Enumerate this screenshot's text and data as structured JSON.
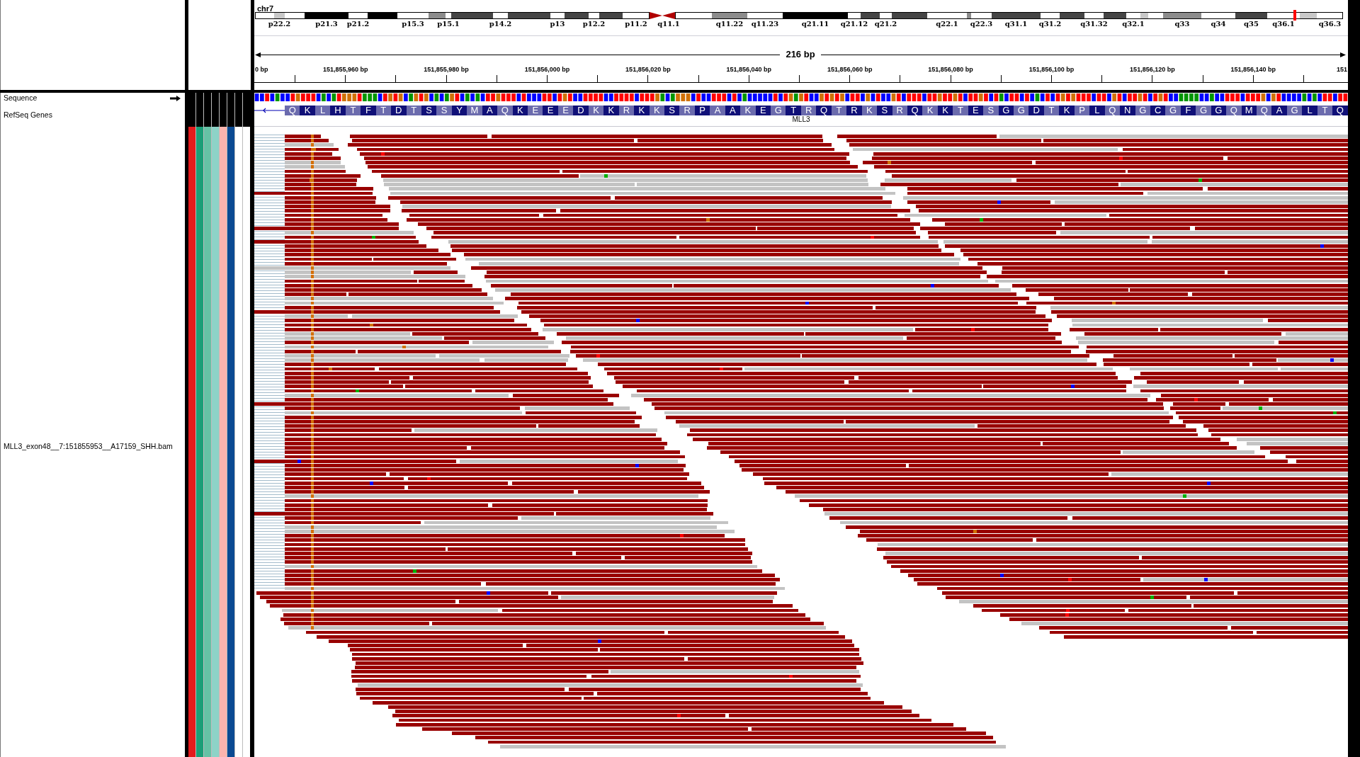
{
  "ideogram": {
    "chromosome": "chr7",
    "bands": [
      {
        "kind": "band",
        "color": "#ffffff",
        "current": false
      },
      {
        "label": "p22.2",
        "kind": "band",
        "color": "#c8c8c8",
        "current": false
      },
      {
        "kind": "band",
        "color": "#ffffff",
        "current": false
      },
      {
        "label": "p21.3",
        "kind": "band",
        "color": "#000000",
        "current": false
      },
      {
        "label": "p21.2",
        "kind": "band",
        "color": "#ffffff",
        "current": false
      },
      {
        "kind": "band",
        "color": "#000000",
        "current": false
      },
      {
        "label": "p15.3",
        "kind": "band",
        "color": "#ffffff",
        "current": false
      },
      {
        "kind": "band",
        "color": "#8c8c8c",
        "current": false
      },
      {
        "label": "p15.1",
        "kind": "band",
        "color": "#ffffff",
        "current": false
      },
      {
        "kind": "band",
        "color": "#454545",
        "current": false
      },
      {
        "label": "p14.2",
        "kind": "band",
        "color": "#ffffff",
        "current": false
      },
      {
        "kind": "band",
        "color": "#454545",
        "current": false
      },
      {
        "label": "p13",
        "kind": "band",
        "color": "#ffffff",
        "current": false
      },
      {
        "kind": "band",
        "color": "#454545",
        "current": false
      },
      {
        "label": "p12.2",
        "kind": "band",
        "color": "#ffffff",
        "current": false
      },
      {
        "kind": "band",
        "color": "#454545",
        "current": false
      },
      {
        "label": "p11.2",
        "kind": "band",
        "color": "#ffffff",
        "current": false
      },
      {
        "kind": "centromere",
        "color": "#b00000",
        "current": false
      },
      {
        "label": "q11.1",
        "kind": "centromere",
        "color": "#b00000",
        "current": false
      },
      {
        "kind": "band",
        "color": "#ffffff",
        "current": false
      },
      {
        "label": "q11.22",
        "kind": "band",
        "color": "#8c8c8c",
        "current": false
      },
      {
        "label": "q11.23",
        "kind": "band",
        "color": "#ffffff",
        "current": false
      },
      {
        "label": "q21.11",
        "kind": "band",
        "color": "#000000",
        "current": false
      },
      {
        "label": "q21.12",
        "kind": "band",
        "color": "#ffffff",
        "current": false
      },
      {
        "kind": "band",
        "color": "#454545",
        "current": false
      },
      {
        "label": "q21.2",
        "kind": "band",
        "color": "#ffffff",
        "current": false
      },
      {
        "kind": "band",
        "color": "#454545",
        "current": false
      },
      {
        "label": "q22.1",
        "kind": "band",
        "color": "#ffffff",
        "current": false
      },
      {
        "kind": "band",
        "color": "#8c8c8c",
        "current": false
      },
      {
        "label": "q22.3",
        "kind": "band",
        "color": "#ffffff",
        "current": false
      },
      {
        "label": "q31.1",
        "kind": "band",
        "color": "#454545",
        "current": false
      },
      {
        "label": "q31.2",
        "kind": "band",
        "color": "#ffffff",
        "current": false
      },
      {
        "kind": "band",
        "color": "#454545",
        "current": false
      },
      {
        "label": "q31.32",
        "kind": "band",
        "color": "#ffffff",
        "current": false
      },
      {
        "kind": "band",
        "color": "#454545",
        "current": false
      },
      {
        "label": "q32.1",
        "kind": "band",
        "color": "#ffffff",
        "current": false
      },
      {
        "kind": "band",
        "color": "#c8c8c8",
        "current": false
      },
      {
        "kind": "band",
        "color": "#ffffff",
        "current": false
      },
      {
        "label": "q33",
        "kind": "band",
        "color": "#8c8c8c",
        "current": false
      },
      {
        "label": "q34",
        "kind": "band",
        "color": "#ffffff",
        "current": false
      },
      {
        "label": "q35",
        "kind": "band",
        "color": "#454545",
        "current": false
      },
      {
        "label": "q36.1",
        "kind": "band",
        "color": "#ffffff",
        "current": true
      },
      {
        "kind": "band",
        "color": "#c8c8c8",
        "current": false
      },
      {
        "label": "q36.3",
        "kind": "band",
        "color": "#ffffff",
        "current": false
      }
    ]
  },
  "ruler": {
    "span": "216 bp",
    "ticks": [
      "0 bp",
      "151,855,960 bp",
      "151,855,980 bp",
      "151,856,000 bp",
      "151,856,020 bp",
      "151,856,040 bp",
      "151,856,060 bp",
      "151,856,080 bp",
      "151,856,100 bp",
      "151,856,120 bp",
      "151,856,140 bp",
      "151"
    ]
  },
  "tracks": [
    {
      "kind": "sequence",
      "label": "Sequence",
      "minus_strand": false,
      "bases": [
        {
          "color": "#0000ff"
        },
        {
          "color": "#0000ff"
        },
        {
          "color": "#ff0000"
        },
        {
          "color": "#0000ff"
        },
        {
          "color": "#009600"
        },
        {
          "color": "#0000ff"
        },
        {
          "color": "#0000ff"
        },
        {
          "color": "#ff0000"
        },
        {
          "color": "#d17105"
        },
        {
          "color": "#ff0000"
        },
        {
          "color": "#ff0000"
        },
        {
          "color": "#ff0000"
        },
        {
          "color": "#0000ff"
        },
        {
          "color": "#009600"
        },
        {
          "color": "#0000ff"
        },
        {
          "color": "#009600"
        },
        {
          "color": "#ff0000"
        },
        {
          "color": "#d17105"
        },
        {
          "color": "#d17105"
        },
        {
          "color": "#d17105"
        },
        {
          "color": "#ff0000"
        },
        {
          "color": "#009600"
        },
        {
          "color": "#009600"
        },
        {
          "color": "#009600"
        },
        {
          "color": "#0000ff"
        },
        {
          "color": "#ff0000"
        },
        {
          "color": "#d17105"
        },
        {
          "color": "#ff0000"
        },
        {
          "color": "#d17105"
        },
        {
          "color": "#0000ff"
        },
        {
          "color": "#009600"
        },
        {
          "color": "#d17105"
        },
        {
          "color": "#ff0000"
        },
        {
          "color": "#d17105"
        },
        {
          "color": "#0000ff"
        },
        {
          "color": "#009600"
        },
        {
          "color": "#0000ff"
        },
        {
          "color": "#009600"
        },
        {
          "color": "#d17105"
        },
        {
          "color": "#ff0000"
        },
        {
          "color": "#0000ff"
        },
        {
          "color": "#009600"
        },
        {
          "color": "#0000ff"
        },
        {
          "color": "#009600"
        },
        {
          "color": "#0000ff"
        },
        {
          "color": "#ff0000"
        },
        {
          "color": "#ff0000"
        },
        {
          "color": "#d17105"
        },
        {
          "color": "#ff0000"
        },
        {
          "color": "#ff0000"
        },
        {
          "color": "#ff0000"
        },
        {
          "color": "#0000ff"
        },
        {
          "color": "#ff0000"
        },
        {
          "color": "#0000ff"
        },
        {
          "color": "#0000ff"
        },
        {
          "color": "#0000ff"
        },
        {
          "color": "#ff0000"
        },
        {
          "color": "#ff0000"
        },
        {
          "color": "#0000ff"
        },
        {
          "color": "#ff0000"
        },
        {
          "color": "#d17105"
        },
        {
          "color": "#ff0000"
        },
        {
          "color": "#0000ff"
        },
        {
          "color": "#0000ff"
        },
        {
          "color": "#ff0000"
        },
        {
          "color": "#ff0000"
        },
        {
          "color": "#ff0000"
        },
        {
          "color": "#ff0000"
        },
        {
          "color": "#0000ff"
        },
        {
          "color": "#0000ff"
        },
        {
          "color": "#ff0000"
        },
        {
          "color": "#ff0000"
        },
        {
          "color": "#ff0000"
        },
        {
          "color": "#ff0000"
        },
        {
          "color": "#0000ff"
        },
        {
          "color": "#ff0000"
        },
        {
          "color": "#ff0000"
        },
        {
          "color": "#ff0000"
        },
        {
          "color": "#d17105"
        },
        {
          "color": "#009600"
        },
        {
          "color": "#0000ff"
        },
        {
          "color": "#009600"
        },
        {
          "color": "#d17105"
        },
        {
          "color": "#d17105"
        },
        {
          "color": "#d17105"
        },
        {
          "color": "#0000ff"
        },
        {
          "color": "#ff0000"
        },
        {
          "color": "#0000ff"
        },
        {
          "color": "#0000ff"
        },
        {
          "color": "#ff0000"
        },
        {
          "color": "#ff0000"
        },
        {
          "color": "#ff0000"
        },
        {
          "color": "#0000ff"
        },
        {
          "color": "#ff0000"
        },
        {
          "color": "#0000ff"
        },
        {
          "color": "#009600"
        },
        {
          "color": "#0000ff"
        },
        {
          "color": "#0000ff"
        },
        {
          "color": "#0000ff"
        },
        {
          "color": "#0000ff"
        },
        {
          "color": "#0000ff"
        },
        {
          "color": "#ff0000"
        },
        {
          "color": "#0000ff"
        },
        {
          "color": "#ff0000"
        },
        {
          "color": "#d17105"
        },
        {
          "color": "#009600"
        },
        {
          "color": "#d17105"
        },
        {
          "color": "#ff0000"
        },
        {
          "color": "#0000ff"
        },
        {
          "color": "#0000ff"
        },
        {
          "color": "#d17105"
        },
        {
          "color": "#ff0000"
        },
        {
          "color": "#d17105"
        },
        {
          "color": "#ff0000"
        },
        {
          "color": "#d17105"
        },
        {
          "color": "#0000ff"
        },
        {
          "color": "#ff0000"
        },
        {
          "color": "#ff0000"
        },
        {
          "color": "#0000ff"
        },
        {
          "color": "#d17105"
        },
        {
          "color": "#0000ff"
        },
        {
          "color": "#ff0000"
        },
        {
          "color": "#0000ff"
        },
        {
          "color": "#0000ff"
        },
        {
          "color": "#d17105"
        },
        {
          "color": "#ff0000"
        },
        {
          "color": "#0000ff"
        },
        {
          "color": "#ff0000"
        },
        {
          "color": "#ff0000"
        },
        {
          "color": "#ff0000"
        },
        {
          "color": "#0000ff"
        },
        {
          "color": "#ff0000"
        },
        {
          "color": "#ff0000"
        },
        {
          "color": "#d17105"
        },
        {
          "color": "#ff0000"
        },
        {
          "color": "#ff0000"
        },
        {
          "color": "#d17105"
        },
        {
          "color": "#ff0000"
        },
        {
          "color": "#0000ff"
        },
        {
          "color": "#ff0000"
        },
        {
          "color": "#ff0000"
        },
        {
          "color": "#d17105"
        },
        {
          "color": "#ff0000"
        },
        {
          "color": "#0000ff"
        },
        {
          "color": "#ff0000"
        },
        {
          "color": "#009600"
        },
        {
          "color": "#0000ff"
        },
        {
          "color": "#ff0000"
        },
        {
          "color": "#ff0000"
        },
        {
          "color": "#0000ff"
        },
        {
          "color": "#ff0000"
        },
        {
          "color": "#0000ff"
        },
        {
          "color": "#009600"
        },
        {
          "color": "#0000ff"
        },
        {
          "color": "#ff0000"
        },
        {
          "color": "#0000ff"
        },
        {
          "color": "#ff0000"
        },
        {
          "color": "#d17105"
        },
        {
          "color": "#ff0000"
        },
        {
          "color": "#d17105"
        },
        {
          "color": "#ff0000"
        },
        {
          "color": "#ff0000"
        },
        {
          "color": "#ff0000"
        },
        {
          "color": "#0000ff"
        },
        {
          "color": "#ff0000"
        },
        {
          "color": "#ff0000"
        },
        {
          "color": "#0000ff"
        },
        {
          "color": "#d17105"
        },
        {
          "color": "#ff0000"
        },
        {
          "color": "#0000ff"
        },
        {
          "color": "#ff0000"
        },
        {
          "color": "#ff0000"
        },
        {
          "color": "#d17105"
        },
        {
          "color": "#ff0000"
        },
        {
          "color": "#0000ff"
        },
        {
          "color": "#ff0000"
        },
        {
          "color": "#d17105"
        },
        {
          "color": "#ff0000"
        },
        {
          "color": "#0000ff"
        },
        {
          "color": "#0000ff"
        },
        {
          "color": "#009600"
        },
        {
          "color": "#009600"
        },
        {
          "color": "#009600"
        },
        {
          "color": "#009600"
        },
        {
          "color": "#0000ff"
        },
        {
          "color": "#0000ff"
        },
        {
          "color": "#009600"
        },
        {
          "color": "#0000ff"
        },
        {
          "color": "#0000ff"
        },
        {
          "color": "#ff0000"
        },
        {
          "color": "#ff0000"
        },
        {
          "color": "#ff0000"
        },
        {
          "color": "#0000ff"
        },
        {
          "color": "#ff0000"
        },
        {
          "color": "#ff0000"
        },
        {
          "color": "#ff0000"
        },
        {
          "color": "#d17105"
        },
        {
          "color": "#0000ff"
        },
        {
          "color": "#d17105"
        },
        {
          "color": "#ff0000"
        },
        {
          "color": "#0000ff"
        },
        {
          "color": "#0000ff"
        },
        {
          "color": "#0000ff"
        },
        {
          "color": "#0000ff"
        },
        {
          "color": "#009600"
        },
        {
          "color": "#0000ff"
        },
        {
          "color": "#009600"
        },
        {
          "color": "#0000ff"
        },
        {
          "color": "#ff0000"
        },
        {
          "color": "#ff0000"
        },
        {
          "color": "#0000ff"
        },
        {
          "color": "#ff0000"
        },
        {
          "color": "#ff0000"
        }
      ]
    },
    {
      "kind": "gene",
      "label": "RefSeq Genes",
      "gene": "MLL3",
      "minus_strand": true,
      "amino_acids": [
        "Q",
        "K",
        "L",
        "H",
        "T",
        "F",
        "T",
        "D",
        "T",
        "S",
        "S",
        "Y",
        "M",
        "A",
        "Q",
        "K",
        "E",
        "E",
        "E",
        "D",
        "K",
        "K",
        "R",
        "K",
        "K",
        "S",
        "R",
        "P",
        "A",
        "A",
        "K",
        "E",
        "G",
        "T",
        "R",
        "Q",
        "T",
        "R",
        "K",
        "S",
        "R",
        "Q",
        "K",
        "K",
        "T",
        "E",
        "S",
        "G",
        "G",
        "D",
        "T",
        "K",
        "P",
        "L",
        "Q",
        "N",
        "G",
        "C",
        "G",
        "F",
        "G",
        "G",
        "Q",
        "M",
        "Q",
        "A",
        "G",
        "L",
        "T",
        "Q"
      ]
    },
    {
      "kind": "alignment",
      "label": "MLL3_exon48__7:151855953__A17159_SHH.bam",
      "attributes": [
        {
          "color": "#e41a1c"
        },
        {
          "color": "#1b9e77"
        },
        {
          "color": "#66c2a5"
        },
        {
          "color": "#8dd3c7"
        },
        {
          "color": "#fbb4ae"
        },
        {
          "color": "#0b4a92"
        },
        {
          "color": "#ffffff"
        },
        {
          "color": "#ffffff"
        }
      ]
    }
  ]
}
